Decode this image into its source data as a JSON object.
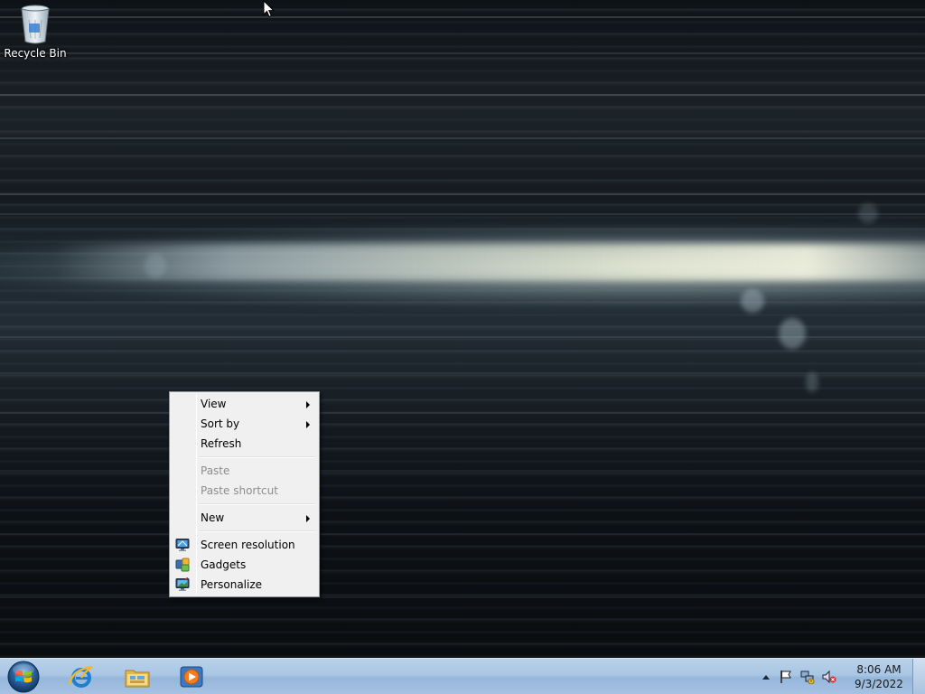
{
  "desktop": {
    "icons": [
      {
        "label": "Recycle Bin",
        "icon": "recycle-bin-icon"
      }
    ]
  },
  "context_menu": {
    "items": [
      {
        "label": "View",
        "submenu": true,
        "enabled": true
      },
      {
        "label": "Sort by",
        "submenu": true,
        "enabled": true
      },
      {
        "label": "Refresh",
        "submenu": false,
        "enabled": true
      },
      {
        "label": "Paste",
        "submenu": false,
        "enabled": false
      },
      {
        "label": "Paste shortcut",
        "submenu": false,
        "enabled": false
      },
      {
        "label": "New",
        "submenu": true,
        "enabled": true
      },
      {
        "label": "Screen resolution",
        "submenu": false,
        "enabled": true,
        "icon": "screen-resolution-icon"
      },
      {
        "label": "Gadgets",
        "submenu": false,
        "enabled": true,
        "icon": "gadgets-icon"
      },
      {
        "label": "Personalize",
        "submenu": false,
        "enabled": true,
        "icon": "personalize-icon"
      }
    ]
  },
  "taskbar": {
    "pinned": [
      {
        "name": "internet-explorer",
        "icon": "internet-explorer-icon"
      },
      {
        "name": "windows-explorer",
        "icon": "folder-icon"
      },
      {
        "name": "media-player",
        "icon": "media-player-icon"
      }
    ],
    "tray": {
      "icons": [
        "action-center-flag-icon",
        "network-icon",
        "volume-muted-icon"
      ]
    },
    "clock": {
      "time": "8:06 AM",
      "date": "9/3/2022"
    }
  },
  "colors": {
    "taskbar": "#a9c6e4",
    "menu_bg": "#f0f0f0",
    "menu_disabled_text": "#8d8d8d"
  }
}
